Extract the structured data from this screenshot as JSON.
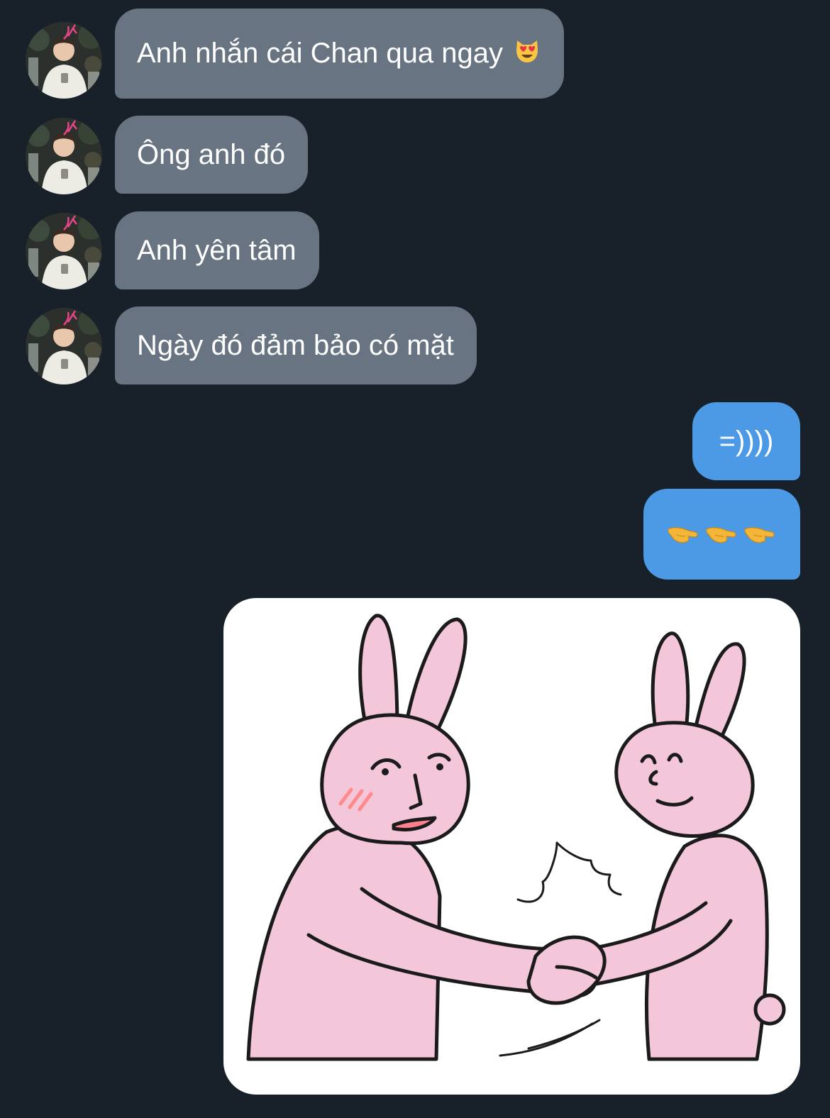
{
  "messages": [
    {
      "sender": "other",
      "text": "Anh nhắn cái Chan qua ngay",
      "emoji": "smiling-cat-heart-eyes"
    },
    {
      "sender": "other",
      "text": "Ông anh đó"
    },
    {
      "sender": "other",
      "text": "Anh yên tâm"
    },
    {
      "sender": "other",
      "text": "Ngày đó đảm bảo có mặt"
    },
    {
      "sender": "me",
      "text": "=))))"
    },
    {
      "sender": "me",
      "text": "",
      "emoji": "pointing-left-hands-x3"
    },
    {
      "sender": "me",
      "type": "sticker",
      "sticker": "pink-rabbits-handshake"
    }
  ],
  "colors": {
    "background": "#18202a",
    "incoming_bubble": "#687482",
    "outgoing_bubble": "#4c9ae6",
    "rabbit_pink": "#f4c6da"
  }
}
